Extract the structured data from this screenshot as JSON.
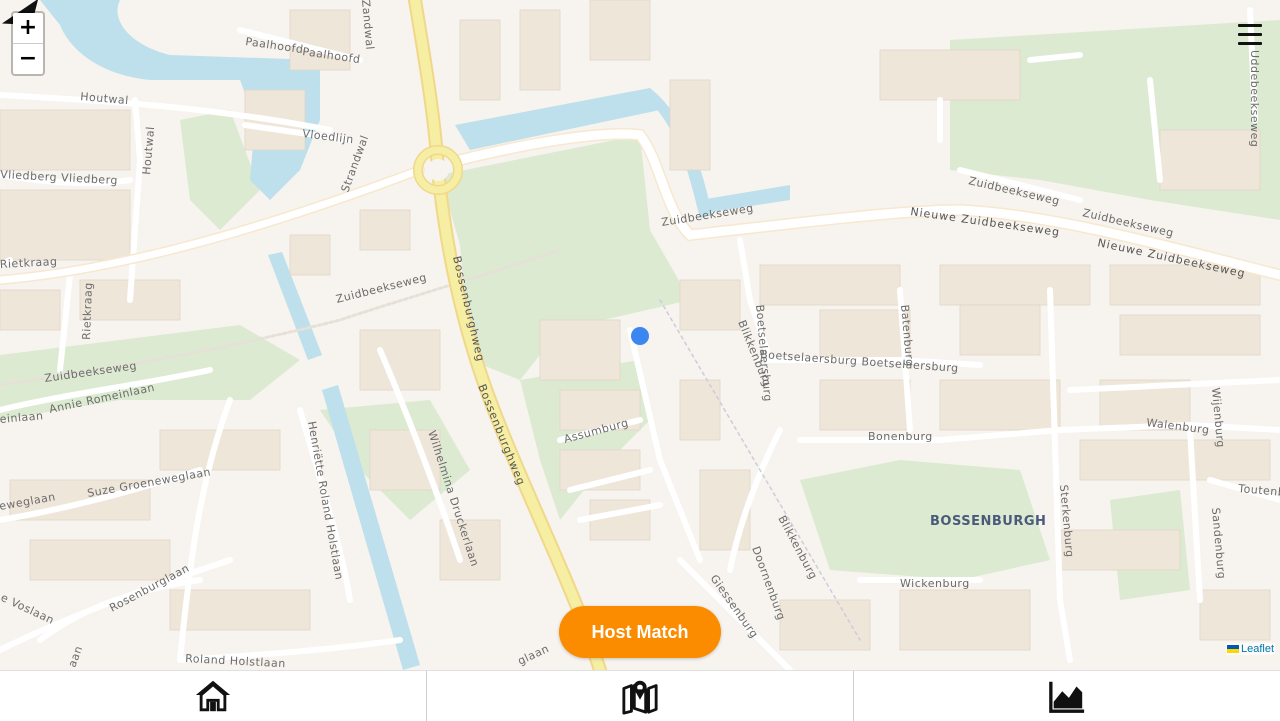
{
  "map": {
    "labels": {
      "paalhoofd": "Paalhoofd",
      "paalhoofd2": "Paalhoofd",
      "houtwal": "Houtwal",
      "houtwal2": "Houtwal",
      "vloedlijn": "Vloedlijn",
      "vliedberg": "Vliedberg Vliedberg",
      "strandwal": "Strandwal",
      "zandwal": "Zandwal",
      "rietkraag": "Rietkraag",
      "rietkraag2": "Rietkraag",
      "zuidbeeksewegWest": "Zuidbeekseweg",
      "zuidbeeksewegMid": "Zuidbeekseweg",
      "zuidbeeksewegNorth": "Zuidbeekseweg",
      "zuidbeeksewegNE": "Zuidbeekseweg",
      "zuidbeeksewegNE2": "Zuidbeekseweg",
      "nieuweZuidbeeksewegA": "Nieuwe Zuidbeekseweg",
      "nieuweZuidbeeksewegB": "Nieuwe Zuidbeekseweg",
      "annieRomeinlaan": "Annie Romeinlaan",
      "einlaan": "einlaan",
      "bossenburghwegA": "Bossenburghweg",
      "bossenburghwegB": "Bossenburghweg",
      "assumburg": "Assumburg",
      "wilhelminaDruckerlaan": "Wilhelmina Druckerlaan",
      "henrietteRolandHolstlaan": "Henriëtte Roland Holstlaan",
      "suzeGroeneweglaan": "Suze Groeneweglaan",
      "eweglaan": "eweglaan",
      "rosenburglaan": "Rosenburglaan",
      "vosiaan": "e Voslaan",
      "rolandHolstlaan": "Roland Holstlaan",
      "glaan": "glaan",
      "aan": "aan",
      "blikkenburgA": "Blikkenburg",
      "blikkenburgB": "Blikkenburg",
      "boetselaersburg": "Boetselaersburg Boetselaersburg",
      "boetselaersburgV": "Boetselaersburg",
      "batenburg": "Batenburg",
      "bonenburg": "Bonenburg",
      "walenburg": "Walenburg",
      "wijenburg": "Wijenburg",
      "toutenburg": "Toutenb",
      "sterkenburg": "Sterkenburg",
      "sandenburg": "Sandenburg",
      "doornenburg": "Doornenburg",
      "giessenburg": "Giessenburg",
      "wickenburg": "Wickenburg",
      "uddelburg": "Uddebeekseweg",
      "district": "BOSSENBURGH"
    }
  },
  "zoom": {
    "in": "+",
    "out": "−"
  },
  "host_match_label": "Host Match",
  "attribution": {
    "label": "Leaflet"
  },
  "nav": {
    "tabs": [
      {
        "name": "home",
        "icon": "home-icon"
      },
      {
        "name": "map",
        "icon": "map-icon"
      },
      {
        "name": "stats",
        "icon": "chart-area-icon"
      }
    ]
  },
  "colors": {
    "accent": "#fb8c00",
    "location": "#3b86f0",
    "water": "#bde0ec",
    "park": "#dbead0",
    "road_major": "#f6eea3",
    "land": "#f7f3ee"
  }
}
